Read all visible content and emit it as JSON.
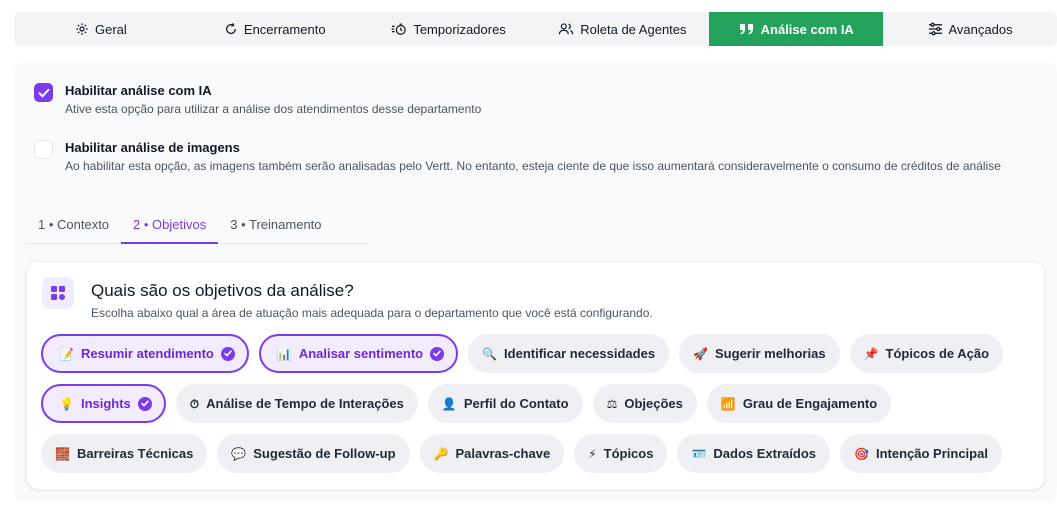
{
  "tabs": [
    {
      "label": "Geral",
      "icon": "gear-icon",
      "glyph": "⚙"
    },
    {
      "label": "Encerramento",
      "icon": "circle-arrow-icon",
      "glyph": "↻"
    },
    {
      "label": "Temporizadores",
      "icon": "timer-icon",
      "glyph": "⏱"
    },
    {
      "label": "Roleta de Agentes",
      "icon": "users-icon",
      "glyph": "👥"
    },
    {
      "label": "Análise com IA",
      "icon": "quote-icon",
      "glyph": "❞",
      "active": true
    },
    {
      "label": "Avançados",
      "icon": "sliders-icon",
      "glyph": "☰"
    }
  ],
  "options": {
    "ai_analysis": {
      "checked": true,
      "title": "Habilitar análise com IA",
      "description": "Ative esta opção para utilizar a análise dos atendimentos desse departamento"
    },
    "image_analysis": {
      "checked": false,
      "title": "Habilitar análise de imagens",
      "description": "Ao habilitar esta opção, as imagens também serão analisadas pelo Vertt. No entanto, esteja ciente de que isso aumentará consideravelmente o consumo de créditos de análise"
    }
  },
  "steps": [
    {
      "label": "1 • Contexto"
    },
    {
      "label": "2 • Objetivos",
      "active": true
    },
    {
      "label": "3 • Treinamento"
    }
  ],
  "objectives": {
    "title": "Quais são os objetivos da análise?",
    "subtitle": "Escolha abaixo qual a área de atuação mais adequada para o departamento que você está configurando.",
    "rows": [
      [
        {
          "label": "Resumir atendimento",
          "emoji": "📝",
          "selected": true
        },
        {
          "label": "Analisar sentimento",
          "emoji": "📊",
          "selected": true
        },
        {
          "label": "Identificar necessidades",
          "emoji": "🔍",
          "selected": false
        },
        {
          "label": "Sugerir melhorias",
          "emoji": "🚀",
          "selected": false
        },
        {
          "label": "Tópicos de Ação",
          "emoji": "📌",
          "selected": false
        }
      ],
      [
        {
          "label": "Insights",
          "emoji": "💡",
          "selected": true
        },
        {
          "label": "Análise de Tempo de Interações",
          "emoji": "⏱",
          "selected": false
        },
        {
          "label": "Perfil do Contato",
          "emoji": "👤",
          "selected": false
        },
        {
          "label": "Objeções",
          "emoji": "⚖",
          "selected": false
        },
        {
          "label": "Grau de Engajamento",
          "emoji": "📶",
          "selected": false
        }
      ],
      [
        {
          "label": "Barreiras Técnicas",
          "emoji": "🧱",
          "selected": false
        },
        {
          "label": "Sugestão de Follow-up",
          "emoji": "💬",
          "selected": false
        },
        {
          "label": "Palavras-chave",
          "emoji": "🔑",
          "selected": false
        },
        {
          "label": "Tópicos",
          "emoji": "⚡",
          "selected": false
        },
        {
          "label": "Dados Extraídos",
          "emoji": "🪪",
          "selected": false
        },
        {
          "label": "Intenção Principal",
          "emoji": "🎯",
          "selected": false
        }
      ]
    ]
  },
  "colors": {
    "active_tab": "#22a25a",
    "accent": "#7c3aed"
  }
}
